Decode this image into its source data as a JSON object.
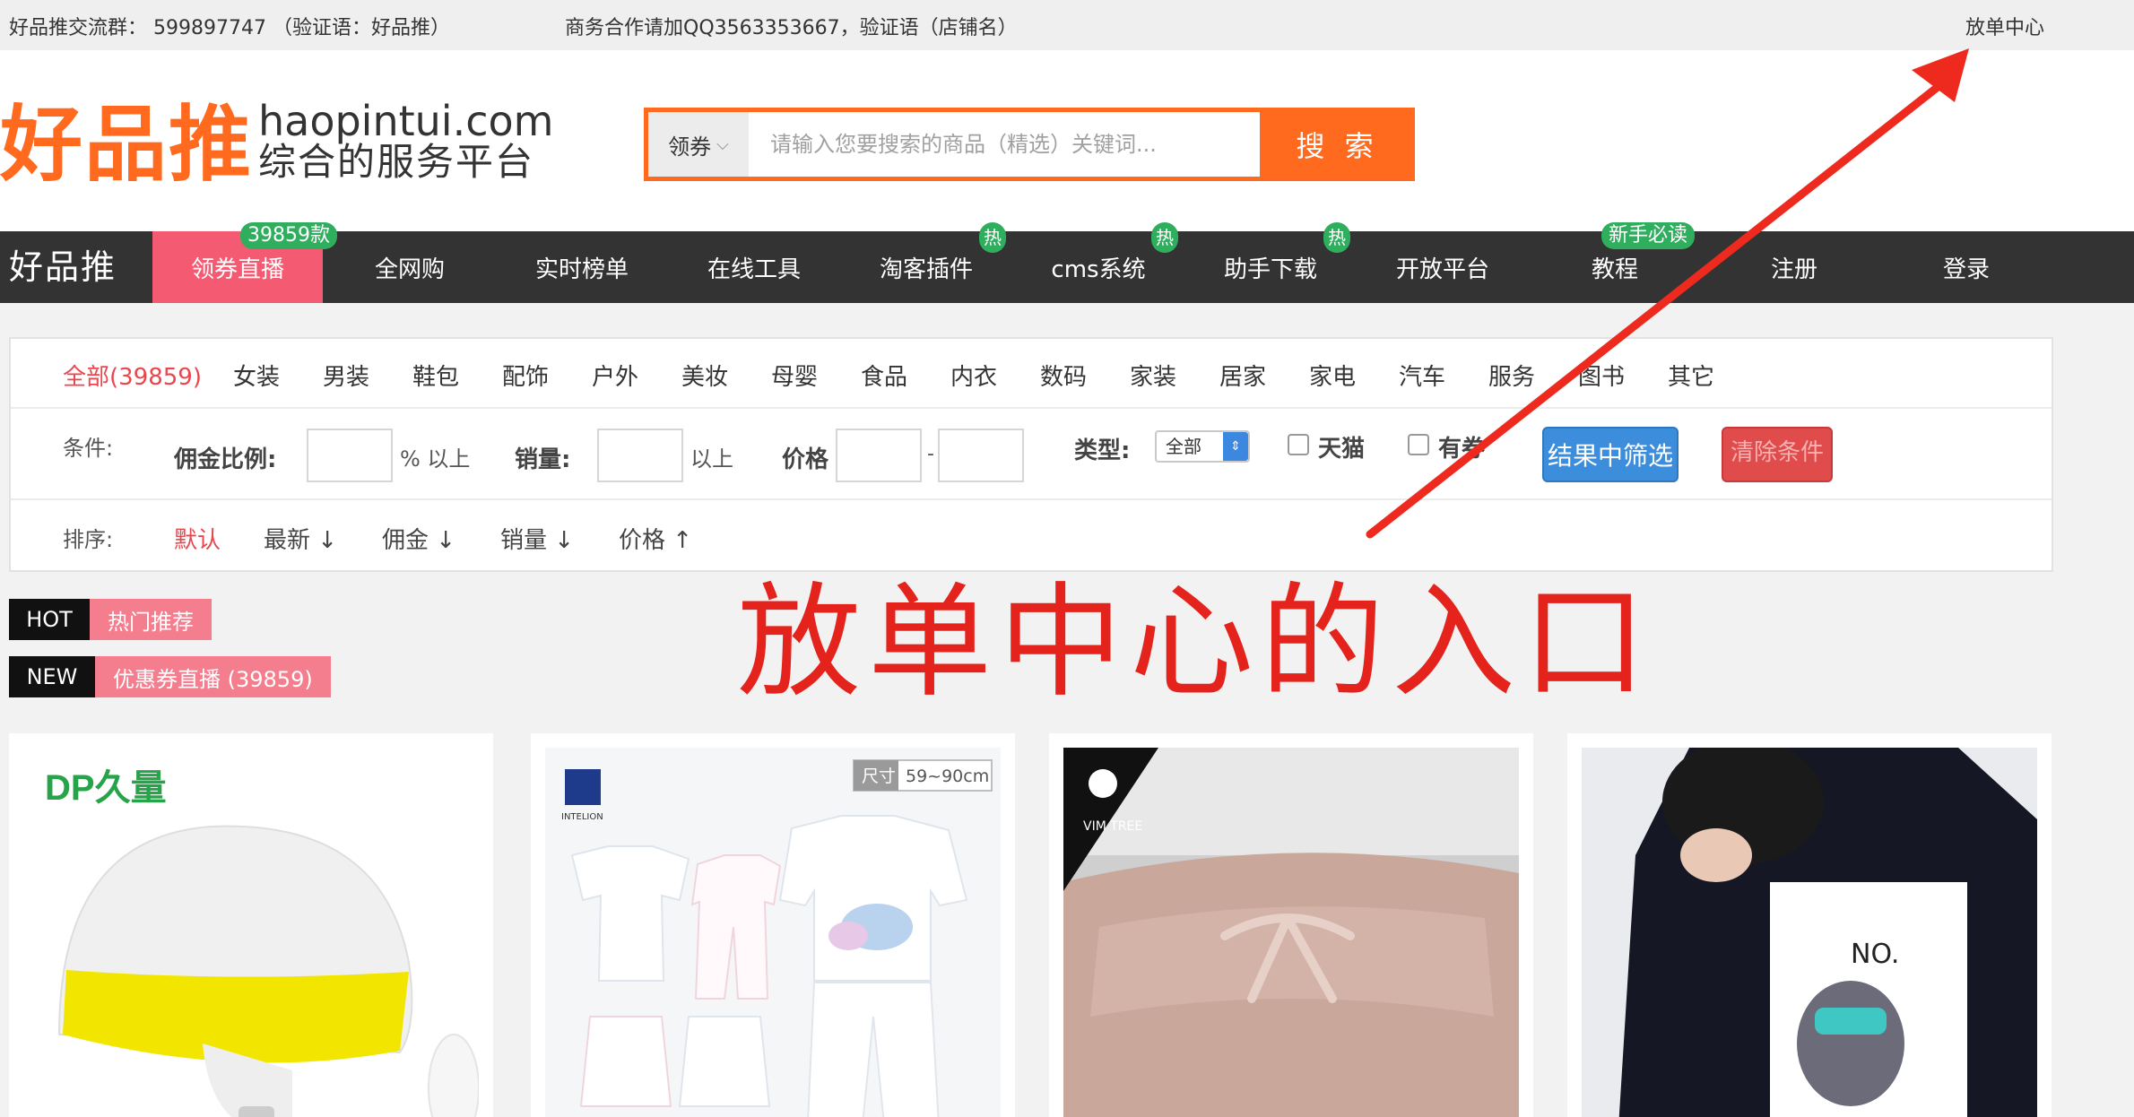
{
  "topbar": {
    "qq_group": "好品推交流群： 599897747 （验证语：好品推）",
    "business": "商务合作请加QQ3563353667，验证语（店铺名）",
    "release_center": "放单中心"
  },
  "header": {
    "logo_cn": "好品推",
    "logo_en": "haopintui.com",
    "logo_slogan": "综合的服务平台",
    "search": {
      "type_label": "领券",
      "placeholder": "请输入您要搜索的商品（精选）关键词...",
      "button_label": "搜 索"
    }
  },
  "nav": {
    "brand": "好品推",
    "items": [
      {
        "label": "领券直播",
        "badge": "39859款"
      },
      {
        "label": "全网购"
      },
      {
        "label": "实时榜单"
      },
      {
        "label": "在线工具"
      },
      {
        "label": "淘客插件",
        "badge": "热"
      },
      {
        "label": "cms系统",
        "badge": "热"
      },
      {
        "label": "助手下载",
        "badge": "热"
      },
      {
        "label": "开放平台"
      },
      {
        "label": "教程",
        "badge": "新手必读"
      },
      {
        "label": "注册"
      },
      {
        "label": "登录"
      }
    ]
  },
  "filter": {
    "categories": [
      "全部(39859)",
      "女装",
      "男装",
      "鞋包",
      "配饰",
      "户外",
      "美妆",
      "母婴",
      "食品",
      "内衣",
      "数码",
      "家装",
      "居家",
      "家电",
      "汽车",
      "服务",
      "图书",
      "其它"
    ],
    "condition_label": "条件:",
    "commission_label": "佣金比例:",
    "commission_unit": "% 以上",
    "sales_label": "销量:",
    "sales_unit": "以上",
    "price_label": "价格",
    "price_sep": "-",
    "type_label": "类型:",
    "type_value": "全部",
    "tmall_label": "天猫",
    "coupon_label": "有券",
    "filter_button": "结果中筛选",
    "clear_button": "清除条件",
    "sort_label": "排序:",
    "sorts": [
      {
        "label": "默认",
        "arrow": ""
      },
      {
        "label": "最新",
        "arrow": "↓"
      },
      {
        "label": "佣金",
        "arrow": "↓"
      },
      {
        "label": "销量",
        "arrow": "↓"
      },
      {
        "label": "价格",
        "arrow": "↑"
      }
    ]
  },
  "tags": {
    "hot_key": "HOT",
    "hot_value": "热门推荐",
    "new_key": "NEW",
    "new_value": "优惠券直播 (39859)"
  },
  "annotation": {
    "text": "放单中心的入口",
    "color": "#e5231d"
  },
  "products": {
    "p1_brand": "DP久量",
    "p2_size_tag": "尺寸",
    "p2_size_value": "59~90cm",
    "p2_brand": "INTELION",
    "p3_brand": "VIM TREE",
    "p4_print": "NO."
  },
  "colors": {
    "accent": "#ff6a1f",
    "nav_bg": "#333333",
    "nav_active": "#f45a72",
    "badge_green": "#2fae5e",
    "danger": "#e04b4b",
    "primary": "#3c8ddb"
  }
}
